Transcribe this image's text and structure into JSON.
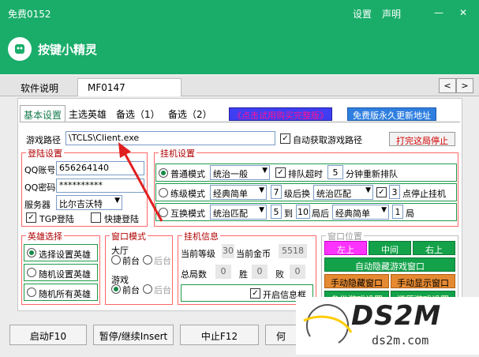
{
  "window": {
    "title": "免费0152",
    "links": [
      "设置",
      "声明"
    ],
    "minimize": "—",
    "close": "✕"
  },
  "app": {
    "name": "按键小精灵"
  },
  "top_tabs": [
    {
      "label": "软件说明",
      "active": false
    },
    {
      "label": "MF0147",
      "active": true
    }
  ],
  "nav_arrows": {
    "left": "<",
    "right": ">"
  },
  "sub_tabs": [
    {
      "label": "基本设置",
      "active": true
    },
    {
      "label": "主选英雄",
      "active": false
    },
    {
      "label": "备选（1）",
      "active": false
    },
    {
      "label": "备选（2）",
      "active": false
    }
  ],
  "buy_link": "《点击试用购买完整版》",
  "free_link": "免费版永久更新地址",
  "game_path": {
    "label": "游戏路径",
    "value": "\\TCLS\\Client.exe",
    "auto_label": "自动获取游戏路径",
    "auto_checked": true,
    "stop_button": "打完这局停止"
  },
  "login": {
    "title": "登陆设置",
    "qq_label": "QQ账号",
    "qq_value": "656264140",
    "pwd_label": "QQ密码",
    "pwd_value": "**********",
    "server_label": "服务器",
    "server_value": "比尔吉沃特",
    "tgp_label": "TGP登陆",
    "tgp_checked": true,
    "quick_label": "快捷登陆",
    "quick_checked": false
  },
  "hang": {
    "title": "挂机设置",
    "row1": {
      "mode_label": "普通模式",
      "selected": true,
      "mode_value": "统治一般",
      "timeout_label": "排队超时",
      "timeout_checked": true,
      "timeout_value": "5",
      "timeout_suffix": "分钟重新排队"
    },
    "row2": {
      "mode_label": "练级模式",
      "selected": false,
      "mode_value": "经典简单",
      "level_value": "7",
      "level_label": "级后换",
      "after_value": "统治匹配",
      "stop_checked": true,
      "stop_value": "3",
      "stop_label": "点停止挂机"
    },
    "row3": {
      "mode_label": "互换模式",
      "selected": false,
      "mode_value": "统治匹配",
      "from_value": "5",
      "to_label": "到",
      "to_value": "10",
      "after_label": "局后",
      "after_value": "经典简单",
      "count_value": "1",
      "count_label": "局"
    }
  },
  "hero": {
    "title": "英雄选择",
    "options": [
      {
        "label": "选择设置英雄",
        "selected": true
      },
      {
        "label": "随机设置英雄",
        "selected": false
      },
      {
        "label": "随机所有英雄",
        "selected": false
      }
    ]
  },
  "window_mode": {
    "title": "窗口模式",
    "lobby_label": "大厅",
    "lobby_options": [
      {
        "label": "前台",
        "selected": false
      },
      {
        "label": "后台",
        "selected": false,
        "disabled": true
      }
    ],
    "game_label": "游戏",
    "game_options": [
      {
        "label": "前台",
        "selected": true
      },
      {
        "label": "后台",
        "selected": false,
        "disabled": true
      }
    ]
  },
  "hang_info": {
    "title": "挂机信息",
    "level_label": "当前等级",
    "level_value": "30",
    "gold_label": "当前金币",
    "gold_value": "5518",
    "total_label": "总局数",
    "total_value": "0",
    "win_label": "胜",
    "win_value": "0",
    "lose_label": "败",
    "lose_value": "0",
    "info_box_label": "开启信息框",
    "info_box_checked": true
  },
  "window_pos": {
    "title": "窗口位置",
    "left": "左上",
    "center": "中间",
    "right": "右上",
    "auto_hide": "自动隐藏游戏窗口",
    "manual_hide": "手动隐藏窗口",
    "manual_show": "手动显示窗口",
    "backup": "备份游戏设置",
    "restore": "还原游戏设置"
  },
  "footer": {
    "start": "启动F10",
    "pause": "暂停/继续Insert",
    "stop": "中止F12",
    "fourth": "何"
  },
  "watermark": {
    "brand": "DS2M",
    "url": "ds2m.com"
  },
  "colors": {
    "title_bar": "#1aad6a",
    "group_border": "#ff6666",
    "green_button": "#13a24a",
    "magenta_button": "#ff33ff",
    "arrow": "#e02020"
  }
}
